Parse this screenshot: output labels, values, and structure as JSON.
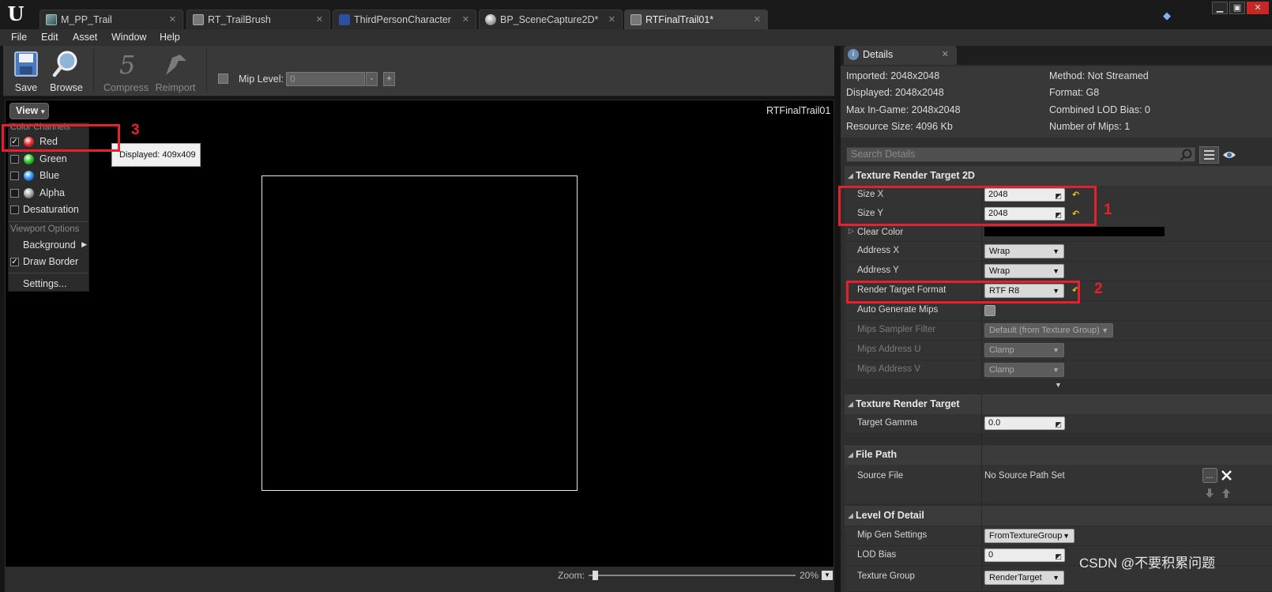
{
  "tabs": [
    {
      "label": "M_PP_Trail",
      "icon": "material-icon"
    },
    {
      "label": "RT_TrailBrush",
      "icon": "texture-icon"
    },
    {
      "label": "ThirdPersonCharacter",
      "icon": "blueprint-icon"
    },
    {
      "label": "BP_SceneCapture2D*",
      "icon": "sphere-icon"
    },
    {
      "label": "RTFinalTrail01*",
      "icon": "texture-icon"
    }
  ],
  "menu": [
    "File",
    "Edit",
    "Asset",
    "Window",
    "Help"
  ],
  "toolbar": {
    "save_label": "Save",
    "browse_label": "Browse",
    "compress_label": "Compress",
    "reimport_label": "Reimport",
    "mip_level_label": "Mip Level:",
    "mip_level_value": "0",
    "minus": "-",
    "plus": "+"
  },
  "viewport": {
    "view_button": "View",
    "asset_name": "RTFinalTrail01",
    "tooltip": "Displayed: 409x409",
    "zoom_label": "Zoom:",
    "zoom_percent": "20%"
  },
  "view_menu": {
    "color_channels_heading": "Color Channels",
    "red": "Red",
    "green": "Green",
    "blue": "Blue",
    "alpha": "Alpha",
    "desaturation": "Desaturation",
    "viewport_options_heading": "Viewport Options",
    "background": "Background",
    "draw_border": "Draw Border",
    "settings": "Settings...",
    "checked": {
      "red": true,
      "green": false,
      "blue": false,
      "alpha": false,
      "desaturation": false,
      "draw_border": true
    }
  },
  "details": {
    "tab_label": "Details",
    "info": {
      "imported": "Imported: 2048x2048",
      "displayed": "Displayed: 2048x2048",
      "max_in_game": "Max In-Game: 2048x2048",
      "resource_size": "Resource Size: 4096 Kb",
      "method": "Method: Not Streamed",
      "format": "Format: G8",
      "combined_lod_bias": "Combined LOD Bias: 0",
      "number_of_mips": "Number of Mips: 1"
    },
    "search_placeholder": "Search Details",
    "texture_render_target_2d": {
      "header": "Texture Render Target 2D",
      "size_x_label": "Size X",
      "size_x": "2048",
      "size_y_label": "Size Y",
      "size_y": "2048",
      "clear_color_label": "Clear Color",
      "address_x_label": "Address X",
      "address_x": "Wrap",
      "address_y_label": "Address Y",
      "address_y": "Wrap",
      "render_target_format_label": "Render Target Format",
      "render_target_format": "RTF R8",
      "auto_generate_mips_label": "Auto Generate Mips",
      "mips_sampler_filter_label": "Mips Sampler Filter",
      "mips_sampler_filter": "Default (from Texture Group)",
      "mips_address_u_label": "Mips Address U",
      "mips_address_u": "Clamp",
      "mips_address_v_label": "Mips Address V",
      "mips_address_v": "Clamp"
    },
    "texture_render_target": {
      "header": "Texture Render Target",
      "target_gamma_label": "Target Gamma",
      "target_gamma": "0.0"
    },
    "file_path": {
      "header": "File Path",
      "source_file_label": "Source File",
      "source_file": "No Source Path Set"
    },
    "level_of_detail": {
      "header": "Level Of Detail",
      "mip_gen_settings_label": "Mip Gen Settings",
      "mip_gen_settings": "FromTextureGroup",
      "lod_bias_label": "LOD Bias",
      "lod_bias": "0",
      "texture_group_label": "Texture Group",
      "texture_group": "RenderTarget"
    }
  },
  "annotations": {
    "one": "1",
    "two": "2",
    "three": "3"
  },
  "watermark": "CSDN @不要积累问题",
  "colors": {
    "annotation_red": "#e8202e",
    "reset_yellow": "#f0c020",
    "window_close": "#c62828"
  }
}
